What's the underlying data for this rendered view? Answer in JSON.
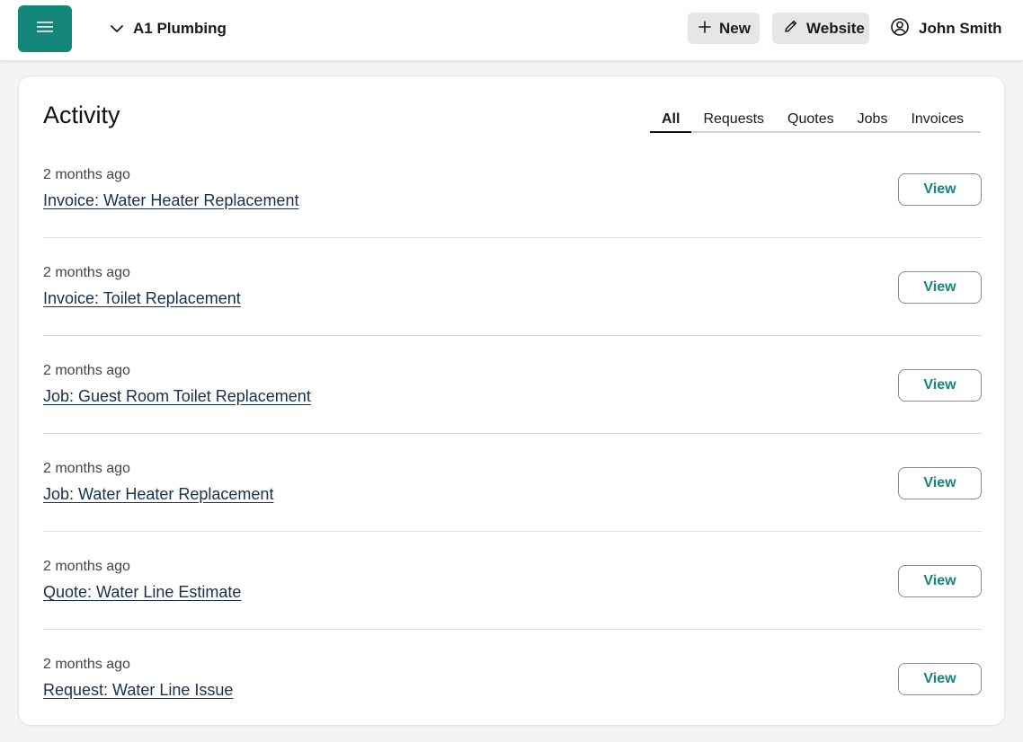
{
  "header": {
    "company_name": "A1 Plumbing",
    "new_label": "New",
    "website_label": "Website",
    "user_name": "John Smith",
    "accent_color": "#12877a"
  },
  "activity": {
    "title": "Activity",
    "tabs": [
      {
        "label": "All",
        "active": true
      },
      {
        "label": "Requests",
        "active": false
      },
      {
        "label": "Quotes",
        "active": false
      },
      {
        "label": "Jobs",
        "active": false
      },
      {
        "label": "Invoices",
        "active": false
      }
    ],
    "items": [
      {
        "time": "2 months ago",
        "title": "Invoice: Water Heater Replacement",
        "action": "View"
      },
      {
        "time": "2 months ago",
        "title": "Invoice: Toilet Replacement",
        "action": "View"
      },
      {
        "time": "2 months ago",
        "title": "Job: Guest Room Toilet Replacement",
        "action": "View"
      },
      {
        "time": "2 months ago",
        "title": "Job: Water Heater Replacement",
        "action": "View"
      },
      {
        "time": "2 months ago",
        "title": "Quote: Water Line Estimate",
        "action": "View"
      },
      {
        "time": "2 months ago",
        "title": "Request: Water Line Issue",
        "action": "View"
      }
    ]
  }
}
